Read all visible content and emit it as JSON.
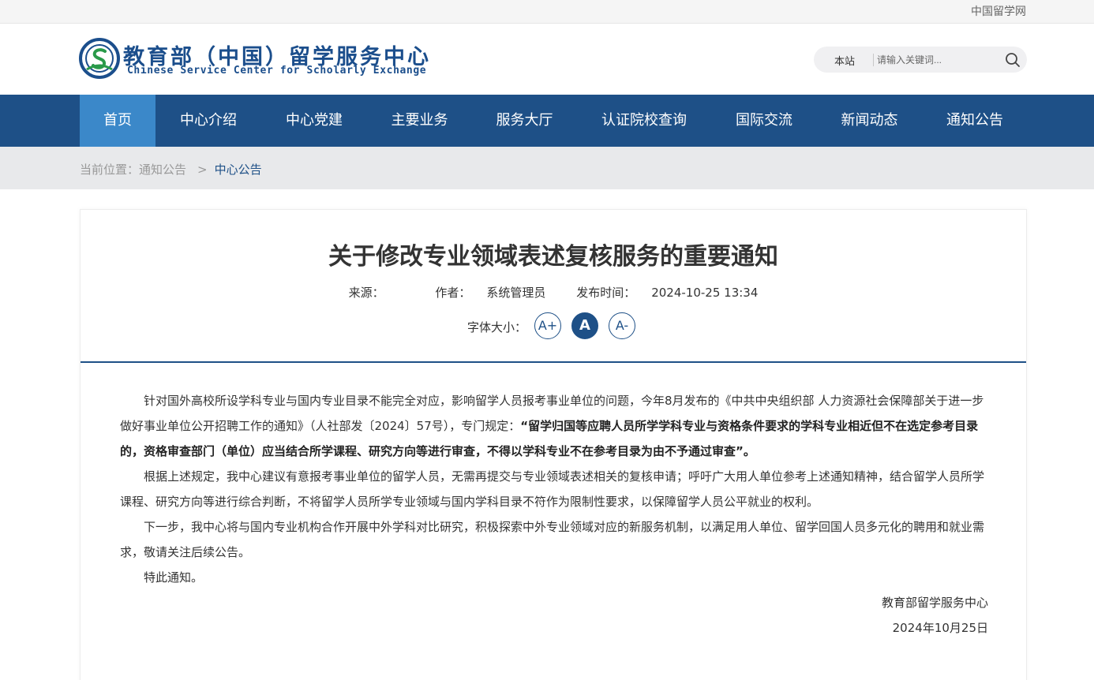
{
  "topbar": {
    "link": "中国留学网"
  },
  "header": {
    "logo_cn": "教育部（中国）留学服务中心",
    "logo_en": "Chinese Service Center for Scholarly Exchange"
  },
  "search": {
    "scope": "本站",
    "placeholder": "请输入关键词..."
  },
  "nav": {
    "items": [
      "首页",
      "中心介绍",
      "中心党建",
      "主要业务",
      "服务大厅",
      "认证院校查询",
      "国际交流",
      "新闻动态",
      "通知公告"
    ],
    "active_index": 0
  },
  "breadcrumb": {
    "prefix": "当前位置：",
    "parent": "通知公告",
    "separator": ">",
    "current": "中心公告"
  },
  "article": {
    "title": "关于修改专业领域表述复核服务的重要通知",
    "source_label": "来源：",
    "source": "",
    "author_label": "作者：",
    "author": "系统管理员",
    "date_label": "发布时间：",
    "date": "2024-10-25 13:34",
    "fontsize_label": "字体大小：",
    "fontsize_buttons": [
      "A+",
      "A",
      "A-"
    ],
    "p1_a": "针对国外高校所设学科专业与国内专业目录不能完全对应，影响留学人员报考事业单位的问题，今年8月发布的《中共中央组织部 人力资源社会保障部关于进一步做好事业单位公开招聘工作的通知》（人社部发〔2024〕57号），专门规定：",
    "p1_b": "“留学归国等应聘人员所学学科专业与资格条件要求的学科专业相近但不在选定参考目录的，资格审查部门（单位）应当结合所学课程、研究方向等进行审查，不得以学科专业不在参考目录为由不予通过审查”",
    "p1_c": "。",
    "p2": "根据上述规定，我中心建议有意报考事业单位的留学人员，无需再提交与专业领域表述相关的复核申请；呼吁广大用人单位参考上述通知精神，结合留学人员所学课程、研究方向等进行综合判断，不将留学人员所学专业领域与国内学科目录不符作为限制性要求，以保障留学人员公平就业的权利。",
    "p3": "下一步，我中心将与国内专业机构合作开展中外学科对比研究，积极探索中外专业领域对应的新服务机制，以满足用人单位、留学回国人员多元化的聘用和就业需求，敬请关注后续公告。",
    "p4": "特此通知。",
    "sign_org": "教育部留学服务中心",
    "sign_date": "2024年10月25日"
  },
  "colors": {
    "primary": "#1e5087",
    "nav_active": "#3b88c9",
    "crumb_bg": "#e8e9eb"
  }
}
